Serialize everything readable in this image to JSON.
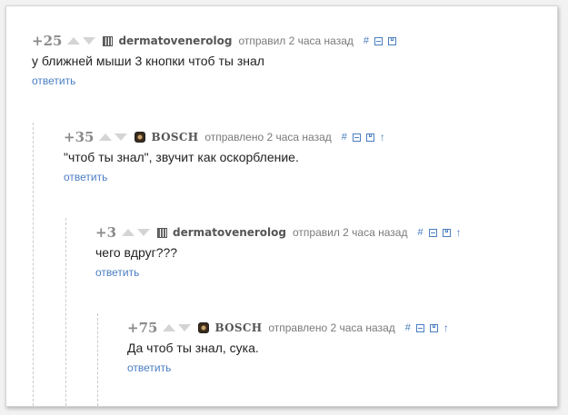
{
  "comments": [
    {
      "rating": "+25",
      "author": "dermatovenerolog",
      "time": "отправил 2 часа назад",
      "text": "у ближней мыши 3 кнопки чтоб ты знал",
      "reply_label": "ответить",
      "avatar": "pattern-avatar",
      "has_parent_link": false
    },
    {
      "rating": "+35",
      "author": "BOSCH",
      "time": "отправлено 2 часа назад",
      "text": "\"чтоб ты знал\", звучит как оскорбление.",
      "reply_label": "ответить",
      "avatar": "bosch-avatar",
      "has_parent_link": true
    },
    {
      "rating": "+3",
      "author": "dermatovenerolog",
      "time": "отправил 2 часа назад",
      "text": "чего вдруг???",
      "reply_label": "ответить",
      "avatar": "pattern-avatar",
      "has_parent_link": true
    },
    {
      "rating": "+75",
      "author": "BOSCH",
      "time": "отправлено 2 часа назад",
      "text": "Да чтоб ты знал, сука.",
      "reply_label": "ответить",
      "avatar": "bosch-avatar",
      "has_parent_link": true
    }
  ],
  "icons": {
    "link": "#",
    "collapse": "minus-box-icon",
    "save": "save-icon",
    "parent": "↑"
  },
  "colors": {
    "link_blue": "#4a7ec2",
    "rating_gray": "#8a8a8a",
    "text": "#222222"
  }
}
